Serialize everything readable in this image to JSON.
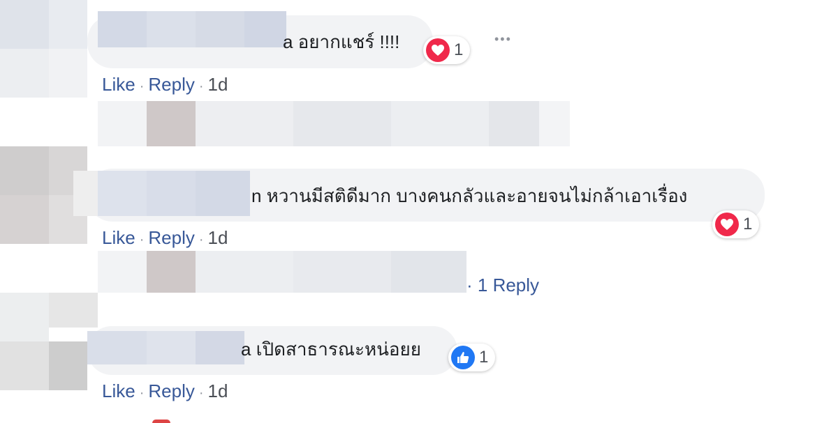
{
  "comments": [
    {
      "text": "a อยากแชร์ !!!!",
      "reaction_icon": "heart-icon",
      "reaction_color": "#f0284a",
      "reaction_count": "1",
      "more_label": "•••",
      "actions": {
        "like": "Like",
        "reply": "Reply",
        "time": "1d"
      }
    },
    {
      "text": "n หวานมีสติดีมาก บางคนกลัวและอายจนไม่กล้าเอาเรื่อง",
      "reaction_icon": "heart-icon",
      "reaction_color": "#f0284a",
      "reaction_count": "1",
      "actions": {
        "like": "Like",
        "reply": "Reply",
        "time": "1d"
      },
      "replies_label": "· 1 Reply"
    },
    {
      "text": "a เปิดสาธารณะหน่อยย",
      "reaction_icon": "thumbs-up-icon",
      "reaction_color": "#2078f4",
      "reaction_count": "1",
      "actions": {
        "like": "Like",
        "reply": "Reply",
        "time": "1d"
      }
    }
  ],
  "separator": "·"
}
